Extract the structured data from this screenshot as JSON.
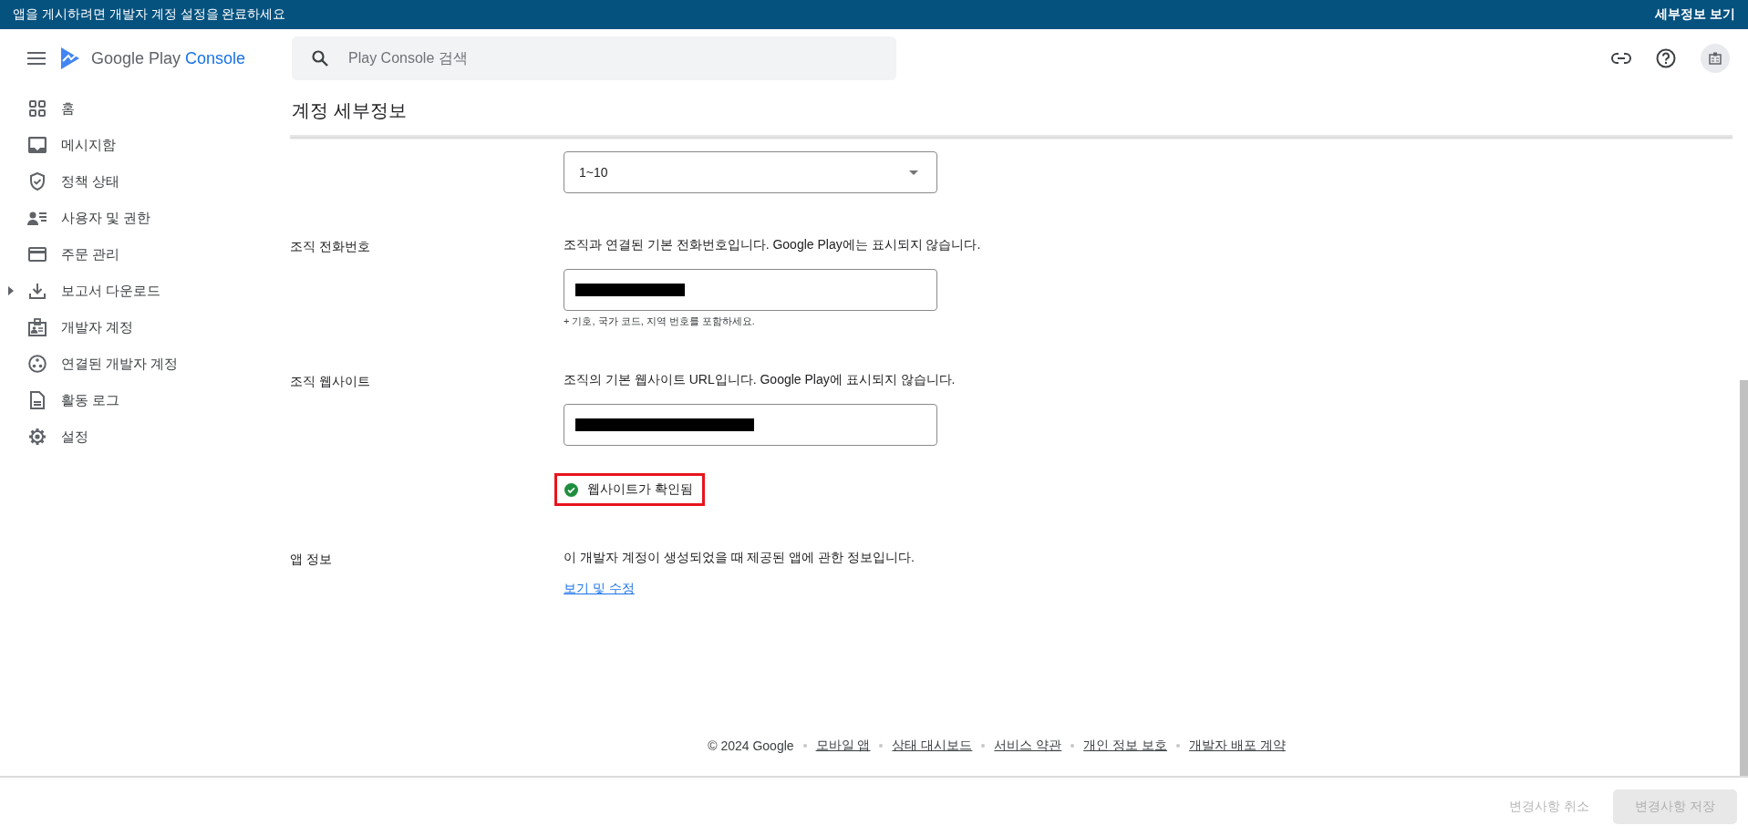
{
  "banner": {
    "message": "앱을 게시하려면 개발자 계정 설정을 완료하세요",
    "action": "세부정보 보기"
  },
  "header": {
    "logo": {
      "brand": "Google Play",
      "product": "Console"
    },
    "search": {
      "placeholder": "Play Console 검색"
    }
  },
  "sidebar": {
    "items": [
      {
        "label": "홈"
      },
      {
        "label": "메시지함"
      },
      {
        "label": "정책 상태"
      },
      {
        "label": "사용자 및 권한"
      },
      {
        "label": "주문 관리"
      },
      {
        "label": "보고서 다운로드",
        "expanded": false
      },
      {
        "label": "개발자 계정"
      },
      {
        "label": "연결된 개발자 계정"
      },
      {
        "label": "활동 로그"
      },
      {
        "label": "설정"
      }
    ]
  },
  "page": {
    "title": "계정 세부정보"
  },
  "form": {
    "size_select": {
      "value": "1~10"
    },
    "sections": [
      {
        "kind": "input",
        "label": "조직 전화번호",
        "description": "조직과 연결된 기본 전화번호입니다. Google Play에는 표시되지 않습니다.",
        "redacted": true,
        "hint": "+ 기호, 국가 코드, 지역 번호를 포함하세요."
      },
      {
        "kind": "input",
        "label": "조직 웹사이트",
        "description": "조직의 기본 웹사이트 URL입니다. Google Play에 표시되지 않습니다.",
        "redacted": true,
        "status": {
          "text": "웹사이트가 확인됨",
          "verified": true,
          "highlighted": true
        }
      },
      {
        "kind": "link",
        "label": "앱 정보",
        "description": "이 개발자 계정이 생성되었을 때 제공된 앱에 관한 정보입니다.",
        "link": "보기 및 수정"
      }
    ]
  },
  "footer": {
    "copyright": "© 2024 Google",
    "links": [
      "모바일 앱",
      "상태 대시보드",
      "서비스 약관",
      "개인 정보 보호",
      "개발자 배포 계약"
    ]
  },
  "actions": {
    "cancel": {
      "label": "변경사항 취소",
      "disabled": true
    },
    "save": {
      "label": "변경사항 저장",
      "disabled": true
    }
  }
}
